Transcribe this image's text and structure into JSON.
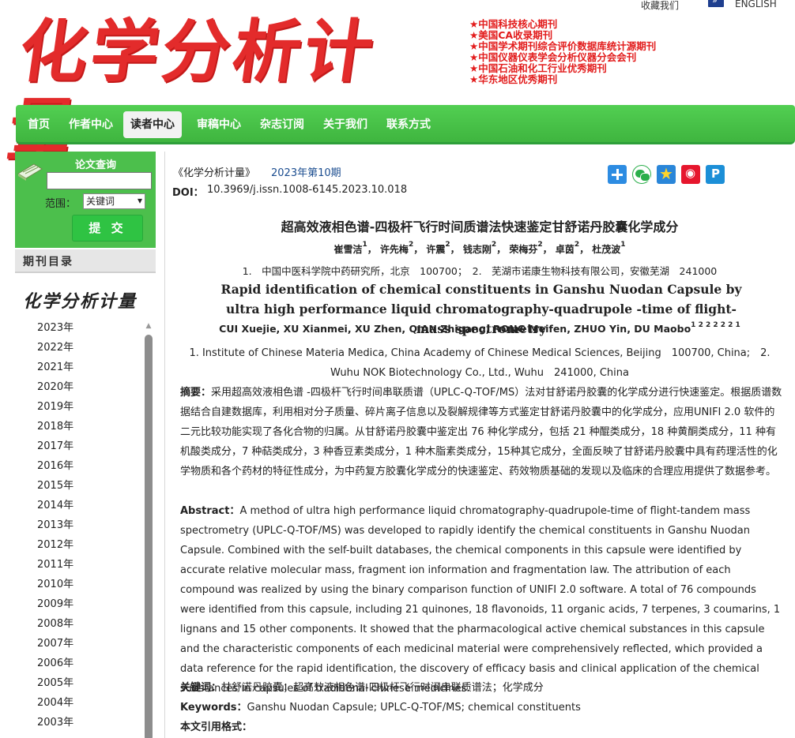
{
  "top_links": {
    "favorite": "收藏我们",
    "english": "ENGLISH"
  },
  "logo": {
    "text": "化学分析计量"
  },
  "honors": [
    "中国科技核心期刊",
    "美国CA收录期刊",
    "中国学术期刊综合评价数据库统计源期刊",
    "中国仪器仪表学会分析仪器分会会刊",
    "中国石油和化工行业优秀期刊",
    "华东地区优秀期刊"
  ],
  "nav": {
    "items": [
      "首页",
      "作者中心",
      "读者中心",
      "审稿中心",
      "杂志订阅",
      "关于我们",
      "联系方式"
    ],
    "active": "读者中心"
  },
  "sidebar": {
    "search_title": "论文查询",
    "search_value": "",
    "scope_label": "范围：",
    "scope_selected": "关键词",
    "submit_label": "提 交",
    "catalog_title": "期刊目录",
    "catalog_logo": "化学分析计量",
    "years": [
      "2023年",
      "2022年",
      "2021年",
      "2020年",
      "2019年",
      "2018年",
      "2017年",
      "2016年",
      "2015年",
      "2014年",
      "2013年",
      "2012年",
      "2011年",
      "2010年",
      "2009年",
      "2008年",
      "2007年",
      "2006年",
      "2005年",
      "2004年",
      "2003年"
    ]
  },
  "article": {
    "journal": "《化学分析计量》",
    "issue": "2023年第10期",
    "doi_label": "DOI：",
    "doi": "10.3969/j.issn.1008-6145.2023.10.018",
    "title_cn": "超高效液相色谱-四极杆飞行时间质谱法快速鉴定甘舒诺丹胶囊化学成分",
    "authors_cn": [
      {
        "name": "崔雪洁",
        "sup": "1"
      },
      {
        "name": "许先梅",
        "sup": "2"
      },
      {
        "name": "许震",
        "sup": "2"
      },
      {
        "name": "钱志刚",
        "sup": "2"
      },
      {
        "name": "荣梅芬",
        "sup": "2"
      },
      {
        "name": "卓茵",
        "sup": "2"
      },
      {
        "name": "杜茂波",
        "sup": "1"
      }
    ],
    "affiliations_cn": "1.　中国中医科学院中药研究所，北京　100700；　2.　芜湖市诺康生物科技有限公司，安徽芜湖　241000",
    "title_en": "Rapid identification of chemical constituents in Ganshu Nuodan Capsule by ultra high performance liquid chromatography-quadrupole -time of flight-mass spectrometry",
    "authors_en": "CUI Xuejie, XU Xianmei, XU Zhen, QIAN Zhigang, RONG Meifen, ZHUO Yin, DU Maobo",
    "authors_en_sup": "1 2 2 2 2 2 1",
    "affiliations_en": "1. Institute of Chinese Materia Medica, China Academy of Chinese Medical Sciences, Beijing　100700, China;　2. Wuhu NOK Biotechnology Co., Ltd., Wuhu　241000, China",
    "abstract_cn_label": "摘要：",
    "abstract_cn": "采用超高效液相色谱 -四极杆飞行时间串联质谱（UPLC-Q-TOF/MS）法对甘舒诺丹胶囊的化学成分进行快速鉴定。根据质谱数据结合自建数据库，利用相对分子质量、碎片离子信息以及裂解规律等方式鉴定甘舒诺丹胶囊中的化学成分，应用UNIFI 2.0 软件的二元比较功能实现了各化合物的归属。从甘舒诺丹胶囊中鉴定出 76 种化学成分，包括 21 种醌类成分，18 种黄酮类成分，11 种有机酸类成分，7 种萜类成分，3 种香豆素类成分，1 种木脂素类成分，15种其它成分，全面反映了甘舒诺丹胶囊中具有药理活性的化学物质和各个药材的特征性成分，为中药复方胶囊化学成分的快速鉴定、药效物质基础的发现以及临床的合理应用提供了数据参考。",
    "abstract_en_label": "Abstract：",
    "abstract_en": "A method of ultra high performance liquid chromatography-quadrupole-time of flight-tandem mass spectrometry (UPLC-Q-TOF/MS) was developed to rapidly identify the chemical constituents in Ganshu Nuodan Capsule. Combined with the self-built databases, the chemical components in this capsule were identified by accurate relative molecular mass, fragment ion information and fragmentation law. The attribution of each compound was realized by using the binary comparison function of UNIFI 2.0 software. A total of 76 compounds were identified from this capsule, including 21 quinones, 18 flavonoids, 11 organic acids, 7 terpenes, 3 coumarins, 1 lignans and 15 other components. It showed that the pharmacological active chemical substances in this capsule and the characteristic components of each medicinal material were comprehensively reflected, which provided a data reference for the rapid identification, the discovery of efficacy basis and clinical application of the chemical substances in capsules of traditional chinese medicines.",
    "keywords_cn_label": "关键词：",
    "keywords_cn": "甘舒诺丹胶囊；超高效液相色谱-四极杆飞行时间串联质谱法；化学成分",
    "keywords_en_label": "Keywords：",
    "keywords_en": "Ganshu Nuodan Capsule; UPLC-Q-TOF/MS; chemical constituents",
    "citation_label": "本文引用格式："
  },
  "share_icons": [
    "share-more-icon",
    "wechat-icon",
    "qzone-icon",
    "weibo-icon",
    "tencent-icon"
  ],
  "colors": {
    "nav_green": "#4cbf4c",
    "honor_red": "#e21b1b",
    "logo_red": "#e32b2b",
    "link_blue": "#1a4c8f"
  }
}
